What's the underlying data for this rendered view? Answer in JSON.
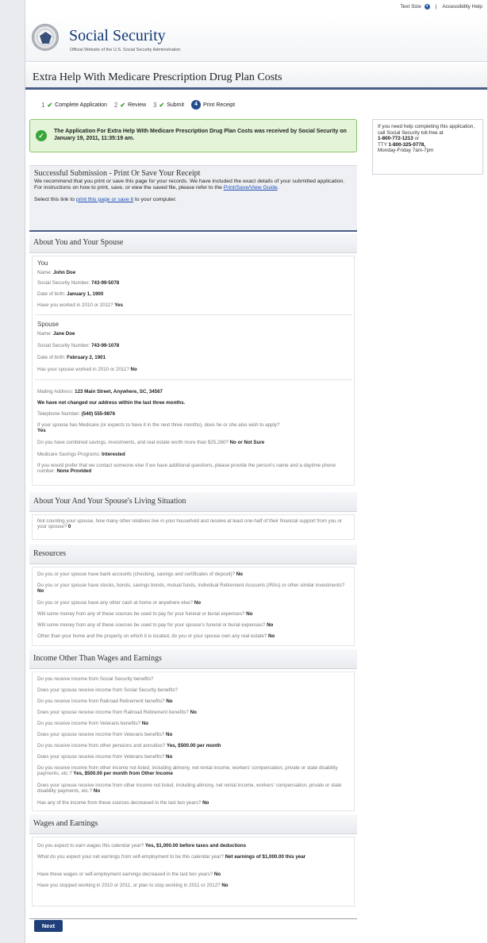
{
  "utility": {
    "text_size": "Text Size",
    "separator": "|",
    "accessibility": "Accessibility Help"
  },
  "brand": {
    "name": "Social Security",
    "tagline": "Official Website of the U.S. Social Security Administration"
  },
  "page_title": "Extra Help With Medicare Prescription Drug Plan Costs",
  "steps": [
    {
      "num": "1",
      "label": "Complete Application"
    },
    {
      "num": "2",
      "label": "Review"
    },
    {
      "num": "3",
      "label": "Submit"
    },
    {
      "num": "4",
      "label": "Print Receipt"
    }
  ],
  "confirmation": "The Application For Extra Help With Medicare Prescription Drug Plan Costs was received by Social Security on January 19, 2011, 11:35:19 am.",
  "help": {
    "intro": "If you need help completing this application, call Social Security toll-free at",
    "phone": "1-800-772-1213",
    "or": "or",
    "tty_label": "TTY",
    "tty": "1-800-325-0778,",
    "hours": "Monday-Friday 7am-7pm"
  },
  "success": {
    "title": "Successful Submission - Print Or Save Your Receipt",
    "body": "We recommend that you print or save this page for your records. We have included the exact details of your submitted application. For instructions on how to print, save, or view the saved file, please refer to the",
    "guide_link": "Print/Save/View Guide",
    "period": ".",
    "select_prefix": "Select this link to",
    "select_link": "print this page or save it",
    "select_suffix": "to your computer."
  },
  "sections": {
    "about": "About You and Your Spouse",
    "living": "About Your And Your Spouse's Living Situation",
    "resources": "Resources",
    "income": "Income Other Than Wages and Earnings",
    "wages": "Wages and Earnings"
  },
  "you": {
    "heading": "You",
    "name_l": "Name:",
    "name": "John Doe",
    "ssn_l": "Social Security Number:",
    "ssn": "743-99-5078",
    "dob_l": "Date of birth:",
    "dob": "January 1, 1900",
    "worked_l": "Have you worked in 2010 or 2011?",
    "worked": "Yes"
  },
  "spouse": {
    "heading": "Spouse",
    "name_l": "Name:",
    "name": "Jane Doe",
    "ssn_l": "Social Security Number:",
    "ssn": "743-99-1078",
    "dob_l": "Date of birth:",
    "dob": "February 2, 1901",
    "worked_l": "Has your spouse worked in 2010 or 2011?",
    "worked": "No"
  },
  "contact": {
    "mail_l": "Mailing Address:",
    "mail": "123 Main Street, Anywhere, SC, 34567",
    "no_change": "We have not changed our address within the last three months.",
    "phone_l": "Telephone Number:",
    "phone": "(540) 555-9876",
    "medicare_q": "If your spouse has Medicare (or expects to have it in the next three months), does he or she also wish to apply?",
    "medicare_a": "Yes",
    "savings_q": "Do you have combined savings, investments, and real estate worth more than $25,260?",
    "savings_a": "No or Not Sure",
    "msp_l": "Medicare Savings Programs:",
    "msp": "Interested",
    "other_q": "If you would prefer that we contact someone else if we have additional questions, please provide the person's name and a daytime phone number:",
    "other_a": "None Provided"
  },
  "living": {
    "q": "Not counting your spouse, how many other relatives live in your household and receive at least one-half of their financial support from you or your spouse?",
    "a": "0"
  },
  "resources": [
    {
      "q": "Do you or your spouse have bank accounts (checking, savings and certificates of deposit)?",
      "a": "No"
    },
    {
      "q": "Do you or your spouse have stocks, bonds, savings bonds, mutual funds, Individual Retirement Accounts (IRAs) or other similar investments?",
      "a": "No"
    },
    {
      "q": "Do you or your spouse have any other cash at home or anywhere else?",
      "a": "No"
    },
    {
      "q": "Will some money from any of these sources be used to pay for your funeral or burial expenses?",
      "a": "No"
    },
    {
      "q": "Will some money from any of these sources be used to pay for your spouse's funeral or burial expenses?",
      "a": "No"
    },
    {
      "q": "Other than your home and the property on which it is located, do you or your spouse own any real estate?",
      "a": "No"
    }
  ],
  "income": [
    {
      "q": "Do you receive income from Social Security benefits?",
      "a": ""
    },
    {
      "q": "Does your spouse receive income from Social Security benefits?",
      "a": ""
    },
    {
      "q": "Do you receive income from Railroad Retirement benefits?",
      "a": "No"
    },
    {
      "q": "Does your spouse receive income from Railroad Retirement benefits?",
      "a": "No"
    },
    {
      "q": "Do you receive income from Veterans benefits?",
      "a": "No"
    },
    {
      "q": "Does your spouse receive income from Veterans benefits?",
      "a": "No"
    },
    {
      "q": "Do you receive income from other pensions and annuities?",
      "a": "Yes, $500.00 per month"
    },
    {
      "q": "Does your spouse receive income from Veterans benefits?",
      "a": "No"
    },
    {
      "q": "Do you receive income from other income not listed, including alimony, net rental income, workers' compensation, private or state disability payments, etc.?",
      "a": "Yes, $500.00 per month from Other Income"
    },
    {
      "q": "Does your spouse receive income from other income not listed, including alimony, net rental income, workers' compensation, private or state disability payments, etc.?",
      "a": "No"
    },
    {
      "q": "Has any of the income from these sources decreased in the last two years?",
      "a": "No"
    }
  ],
  "wages": [
    {
      "q": "Do you expect to earn wages this calendar year?",
      "a": "Yes, $1,000.00 before taxes and deductions"
    },
    {
      "q": "What do you expect your net earnings from self-employment to be this calendar year?",
      "a": "Net earnings of $1,000.00 this year"
    },
    {
      "q": "Have these wages or self-employment earnings decreased in the last two years?",
      "a": "No"
    },
    {
      "q": "Have you stopped working in 2010 or 2011, or plan to stop working in 2011 or 2012?",
      "a": "No"
    }
  ],
  "next_label": "Next"
}
